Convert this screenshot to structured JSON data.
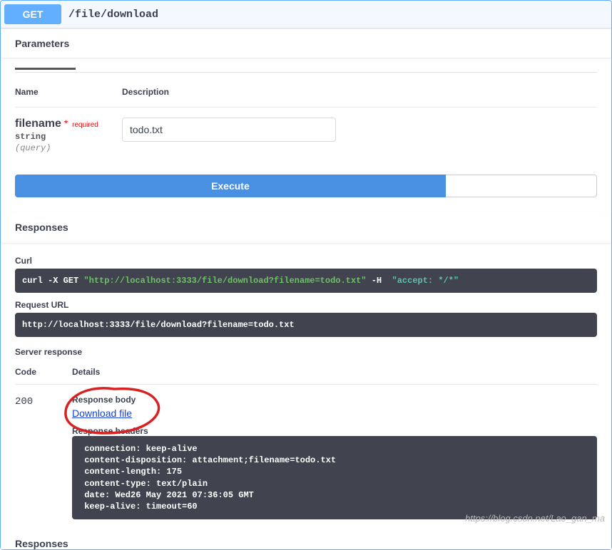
{
  "summary": {
    "method": "GET",
    "path": "/file/download"
  },
  "parameters": {
    "section_title": "Parameters",
    "col_name": "Name",
    "col_desc": "Description",
    "rows": [
      {
        "name": "filename",
        "required_star": "*",
        "required_text": "required",
        "type": "string",
        "in": "(query)",
        "value": "todo.txt"
      }
    ]
  },
  "actions": {
    "execute": "Execute"
  },
  "responses": {
    "title": "Responses",
    "curl_label": "Curl",
    "curl": {
      "prefix": "curl -X GET ",
      "url": "\"http://localhost:3333/file/download?filename=todo.txt\"",
      "flag": " -H  ",
      "accept": "\"accept: */*\""
    },
    "request_url_label": "Request URL",
    "request_url": "http://localhost:3333/file/download?filename=todo.txt",
    "server_response_label": "Server response",
    "code_col": "Code",
    "details_col": "Details",
    "status_code": "200",
    "response_body_label": "Response body",
    "download_link": "Download file",
    "response_headers_label": "Response headers",
    "headers_text": " connection: keep-alive\n content-disposition: attachment;filename=todo.txt\n content-length: 175\n content-type: text/plain\n date: Wed26 May 2021 07:36:05 GMT\n keep-alive: timeout=60",
    "footer": "Responses"
  },
  "watermark": "https://blog.csdn.net/Lao_gan_ma"
}
